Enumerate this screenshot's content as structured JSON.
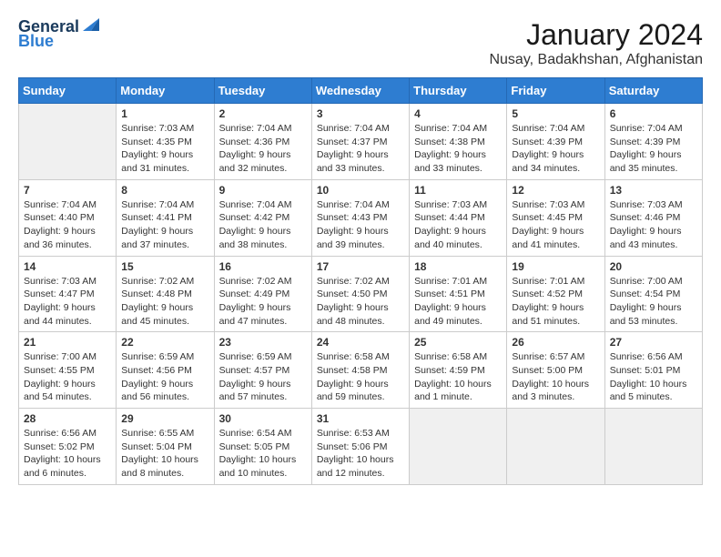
{
  "header": {
    "logo_line1": "General",
    "logo_line2": "Blue",
    "title": "January 2024",
    "subtitle": "Nusay, Badakhshan, Afghanistan"
  },
  "days": [
    "Sunday",
    "Monday",
    "Tuesday",
    "Wednesday",
    "Thursday",
    "Friday",
    "Saturday"
  ],
  "weeks": [
    [
      {
        "date": "",
        "sunrise": "",
        "sunset": "",
        "daylight": "",
        "empty": true
      },
      {
        "date": "1",
        "sunrise": "Sunrise: 7:03 AM",
        "sunset": "Sunset: 4:35 PM",
        "daylight": "Daylight: 9 hours and 31 minutes."
      },
      {
        "date": "2",
        "sunrise": "Sunrise: 7:04 AM",
        "sunset": "Sunset: 4:36 PM",
        "daylight": "Daylight: 9 hours and 32 minutes."
      },
      {
        "date": "3",
        "sunrise": "Sunrise: 7:04 AM",
        "sunset": "Sunset: 4:37 PM",
        "daylight": "Daylight: 9 hours and 33 minutes."
      },
      {
        "date": "4",
        "sunrise": "Sunrise: 7:04 AM",
        "sunset": "Sunset: 4:38 PM",
        "daylight": "Daylight: 9 hours and 33 minutes."
      },
      {
        "date": "5",
        "sunrise": "Sunrise: 7:04 AM",
        "sunset": "Sunset: 4:39 PM",
        "daylight": "Daylight: 9 hours and 34 minutes."
      },
      {
        "date": "6",
        "sunrise": "Sunrise: 7:04 AM",
        "sunset": "Sunset: 4:39 PM",
        "daylight": "Daylight: 9 hours and 35 minutes."
      }
    ],
    [
      {
        "date": "7",
        "sunrise": "Sunrise: 7:04 AM",
        "sunset": "Sunset: 4:40 PM",
        "daylight": "Daylight: 9 hours and 36 minutes."
      },
      {
        "date": "8",
        "sunrise": "Sunrise: 7:04 AM",
        "sunset": "Sunset: 4:41 PM",
        "daylight": "Daylight: 9 hours and 37 minutes."
      },
      {
        "date": "9",
        "sunrise": "Sunrise: 7:04 AM",
        "sunset": "Sunset: 4:42 PM",
        "daylight": "Daylight: 9 hours and 38 minutes."
      },
      {
        "date": "10",
        "sunrise": "Sunrise: 7:04 AM",
        "sunset": "Sunset: 4:43 PM",
        "daylight": "Daylight: 9 hours and 39 minutes."
      },
      {
        "date": "11",
        "sunrise": "Sunrise: 7:03 AM",
        "sunset": "Sunset: 4:44 PM",
        "daylight": "Daylight: 9 hours and 40 minutes."
      },
      {
        "date": "12",
        "sunrise": "Sunrise: 7:03 AM",
        "sunset": "Sunset: 4:45 PM",
        "daylight": "Daylight: 9 hours and 41 minutes."
      },
      {
        "date": "13",
        "sunrise": "Sunrise: 7:03 AM",
        "sunset": "Sunset: 4:46 PM",
        "daylight": "Daylight: 9 hours and 43 minutes."
      }
    ],
    [
      {
        "date": "14",
        "sunrise": "Sunrise: 7:03 AM",
        "sunset": "Sunset: 4:47 PM",
        "daylight": "Daylight: 9 hours and 44 minutes."
      },
      {
        "date": "15",
        "sunrise": "Sunrise: 7:02 AM",
        "sunset": "Sunset: 4:48 PM",
        "daylight": "Daylight: 9 hours and 45 minutes."
      },
      {
        "date": "16",
        "sunrise": "Sunrise: 7:02 AM",
        "sunset": "Sunset: 4:49 PM",
        "daylight": "Daylight: 9 hours and 47 minutes."
      },
      {
        "date": "17",
        "sunrise": "Sunrise: 7:02 AM",
        "sunset": "Sunset: 4:50 PM",
        "daylight": "Daylight: 9 hours and 48 minutes."
      },
      {
        "date": "18",
        "sunrise": "Sunrise: 7:01 AM",
        "sunset": "Sunset: 4:51 PM",
        "daylight": "Daylight: 9 hours and 49 minutes."
      },
      {
        "date": "19",
        "sunrise": "Sunrise: 7:01 AM",
        "sunset": "Sunset: 4:52 PM",
        "daylight": "Daylight: 9 hours and 51 minutes."
      },
      {
        "date": "20",
        "sunrise": "Sunrise: 7:00 AM",
        "sunset": "Sunset: 4:54 PM",
        "daylight": "Daylight: 9 hours and 53 minutes."
      }
    ],
    [
      {
        "date": "21",
        "sunrise": "Sunrise: 7:00 AM",
        "sunset": "Sunset: 4:55 PM",
        "daylight": "Daylight: 9 hours and 54 minutes."
      },
      {
        "date": "22",
        "sunrise": "Sunrise: 6:59 AM",
        "sunset": "Sunset: 4:56 PM",
        "daylight": "Daylight: 9 hours and 56 minutes."
      },
      {
        "date": "23",
        "sunrise": "Sunrise: 6:59 AM",
        "sunset": "Sunset: 4:57 PM",
        "daylight": "Daylight: 9 hours and 57 minutes."
      },
      {
        "date": "24",
        "sunrise": "Sunrise: 6:58 AM",
        "sunset": "Sunset: 4:58 PM",
        "daylight": "Daylight: 9 hours and 59 minutes."
      },
      {
        "date": "25",
        "sunrise": "Sunrise: 6:58 AM",
        "sunset": "Sunset: 4:59 PM",
        "daylight": "Daylight: 10 hours and 1 minute."
      },
      {
        "date": "26",
        "sunrise": "Sunrise: 6:57 AM",
        "sunset": "Sunset: 5:00 PM",
        "daylight": "Daylight: 10 hours and 3 minutes."
      },
      {
        "date": "27",
        "sunrise": "Sunrise: 6:56 AM",
        "sunset": "Sunset: 5:01 PM",
        "daylight": "Daylight: 10 hours and 5 minutes."
      }
    ],
    [
      {
        "date": "28",
        "sunrise": "Sunrise: 6:56 AM",
        "sunset": "Sunset: 5:02 PM",
        "daylight": "Daylight: 10 hours and 6 minutes."
      },
      {
        "date": "29",
        "sunrise": "Sunrise: 6:55 AM",
        "sunset": "Sunset: 5:04 PM",
        "daylight": "Daylight: 10 hours and 8 minutes."
      },
      {
        "date": "30",
        "sunrise": "Sunrise: 6:54 AM",
        "sunset": "Sunset: 5:05 PM",
        "daylight": "Daylight: 10 hours and 10 minutes."
      },
      {
        "date": "31",
        "sunrise": "Sunrise: 6:53 AM",
        "sunset": "Sunset: 5:06 PM",
        "daylight": "Daylight: 10 hours and 12 minutes."
      },
      {
        "date": "",
        "sunrise": "",
        "sunset": "",
        "daylight": "",
        "empty": true
      },
      {
        "date": "",
        "sunrise": "",
        "sunset": "",
        "daylight": "",
        "empty": true
      },
      {
        "date": "",
        "sunrise": "",
        "sunset": "",
        "daylight": "",
        "empty": true
      }
    ]
  ]
}
